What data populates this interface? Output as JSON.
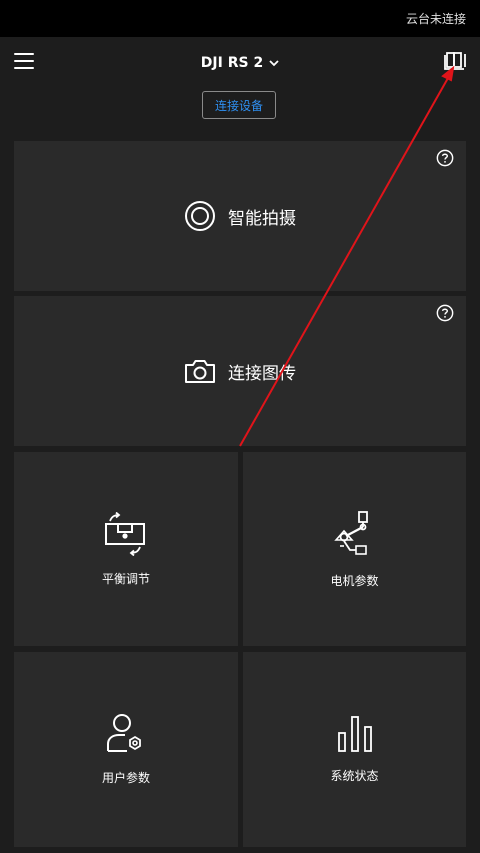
{
  "status_bar": {
    "text": "云台未连接"
  },
  "header": {
    "title": "DJI RS 2",
    "connect_button": "连接设备"
  },
  "cards": {
    "smart_shoot": {
      "label": "智能拍摄"
    },
    "connect_transmission": {
      "label": "连接图传"
    },
    "balance": {
      "label": "平衡调节"
    },
    "motor_params": {
      "label": "电机参数"
    },
    "user_params": {
      "label": "用户参数"
    },
    "system_status": {
      "label": "系统状态"
    }
  },
  "icons": {
    "menu": "menu-icon",
    "dropdown": "chevron-down-icon",
    "manual": "book-icon",
    "help": "help-icon",
    "smart_shoot": "target-icon",
    "camera": "camera-icon",
    "balance": "level-icon",
    "motor": "gimbal-arm-icon",
    "user": "user-gear-icon",
    "system": "bar-chart-icon"
  },
  "colors": {
    "background": "#1d1d1d",
    "card": "#2a2a2a",
    "accent_blue": "#2f8ff0",
    "annotation_arrow": "#e0141a"
  }
}
